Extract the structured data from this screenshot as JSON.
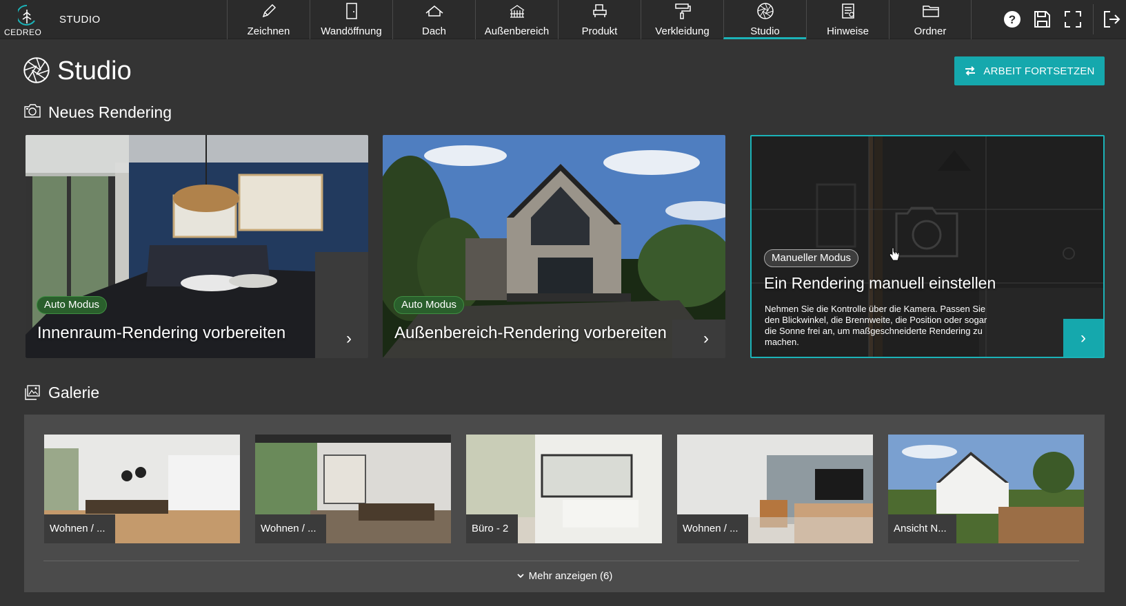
{
  "app": {
    "logo_text": "CEDREO",
    "name": "STUDIO"
  },
  "nav": {
    "items": [
      {
        "label": "Zeichnen",
        "icon": "pencil-icon"
      },
      {
        "label": "Wandöffnung",
        "icon": "door-icon"
      },
      {
        "label": "Dach",
        "icon": "roof-icon"
      },
      {
        "label": "Außenbereich",
        "icon": "terrace-icon"
      },
      {
        "label": "Produkt",
        "icon": "armchair-icon"
      },
      {
        "label": "Verkleidung",
        "icon": "paint-roller-icon"
      },
      {
        "label": "Studio",
        "icon": "camera-aperture-icon",
        "active": true
      },
      {
        "label": "Hinweise",
        "icon": "annotation-icon"
      },
      {
        "label": "Ordner",
        "icon": "folder-icon"
      }
    ]
  },
  "toolbar": {
    "help_icon": "help-icon",
    "save_icon": "save-icon",
    "fullscreen_icon": "fullscreen-icon",
    "exit_icon": "exit-icon"
  },
  "header": {
    "title": "Studio",
    "continue_label": "ARBEIT FORTSETZEN"
  },
  "new_rendering": {
    "title": "Neues Rendering",
    "cards": [
      {
        "tag": "Auto Modus",
        "title": "Innenraum-Rendering vorbereiten"
      },
      {
        "tag": "Auto Modus",
        "title": "Außenbereich-Rendering vorbereiten"
      },
      {
        "tag": "Manueller Modus",
        "title": "Ein Rendering manuell einstellen",
        "description": "Nehmen Sie die Kontrolle über die Kamera. Passen Sie den Blickwinkel, die Brennweite, die Position oder sogar die Sonne frei an, um maßgeschneiderte Rendering zu machen."
      }
    ]
  },
  "gallery": {
    "title": "Galerie",
    "items": [
      {
        "label": "Wohnen / ..."
      },
      {
        "label": "Wohnen / ..."
      },
      {
        "label": "Büro - 2"
      },
      {
        "label": "Wohnen / ..."
      },
      {
        "label": "Ansicht N..."
      }
    ],
    "more_label": "Mehr anzeigen (6)"
  },
  "colors": {
    "accent": "#15a8ad",
    "background": "#343434",
    "topbar": "#2b2b2b",
    "auto_tag": "#2a5f2c"
  }
}
